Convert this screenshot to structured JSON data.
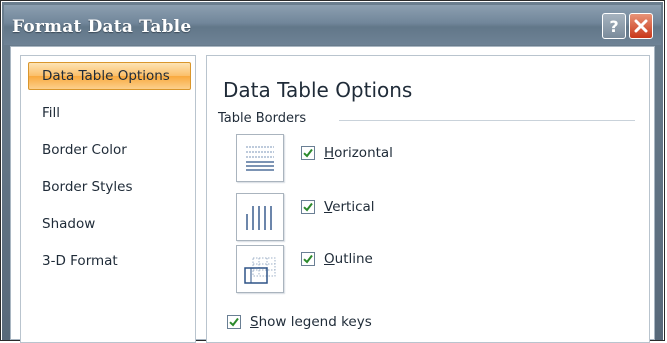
{
  "window": {
    "title": "Format Data Table",
    "help_glyph": "?",
    "close_glyph": "X"
  },
  "sidebar": {
    "items": [
      {
        "label": "Data Table Options",
        "selected": true
      },
      {
        "label": "Fill",
        "selected": false
      },
      {
        "label": "Border Color",
        "selected": false
      },
      {
        "label": "Border Styles",
        "selected": false
      },
      {
        "label": "Shadow",
        "selected": false
      },
      {
        "label": "3-D Format",
        "selected": false
      }
    ]
  },
  "panel": {
    "title": "Data Table Options",
    "group_label": "Table Borders",
    "options": [
      {
        "accel": "H",
        "rest": "orizontal",
        "checked": true,
        "preview_icon": "horizontal-borders-icon"
      },
      {
        "accel": "V",
        "rest": "ertical",
        "checked": true,
        "preview_icon": "vertical-borders-icon"
      },
      {
        "accel": "O",
        "rest": "utline",
        "checked": true,
        "preview_icon": "outline-border-icon"
      }
    ],
    "legend_keys": {
      "accel": "S",
      "rest": "how legend keys",
      "checked": true
    }
  },
  "colors": {
    "title_bar": "#71869a",
    "selected_item": "#fbbf6a",
    "close_button": "#c9371a",
    "checkmark": "#2c8a2c"
  }
}
